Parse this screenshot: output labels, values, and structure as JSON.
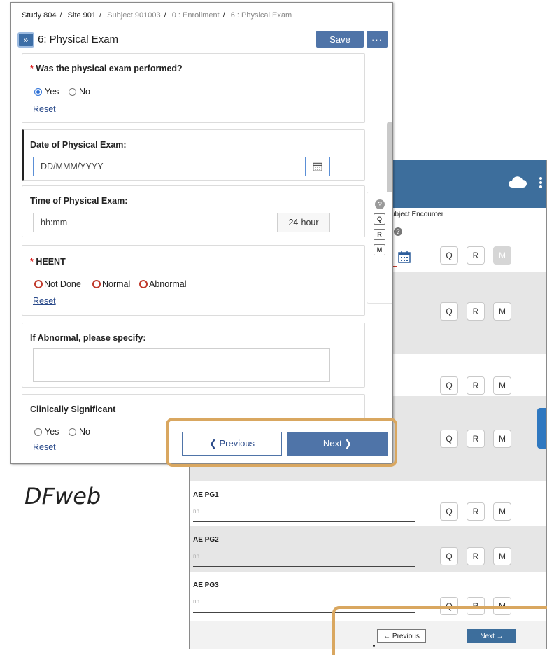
{
  "caption": "DFweb",
  "front": {
    "breadcrumb": [
      {
        "text": "Study 804",
        "muted": false
      },
      {
        "text": "Site 901",
        "muted": false
      },
      {
        "text": "Subject 901003",
        "muted": true
      },
      {
        "text": "0 : Enrollment",
        "muted": true
      },
      {
        "text": "6 : Physical Exam",
        "muted": true
      }
    ],
    "expand_glyph": "»",
    "title": "6: Physical Exam",
    "save_label": "Save",
    "more_label": "···",
    "q1": {
      "required": "*",
      "label": "Was the physical exam performed?",
      "opt_yes": "Yes",
      "opt_no": "No",
      "selected": "Yes",
      "reset": "Reset"
    },
    "q2": {
      "label": "Date of Physical Exam:",
      "placeholder": "DD/MMM/YYYY"
    },
    "q3": {
      "label": "Time of Physical Exam:",
      "placeholder": "hh:mm",
      "suffix": "24-hour"
    },
    "q4": {
      "required": "*",
      "label": "HEENT",
      "opt1": "Not Done",
      "opt2": "Normal",
      "opt3": "Abnormal",
      "reset": "Reset"
    },
    "q5": {
      "label": "If Abnormal, please specify:"
    },
    "q6": {
      "label": "Clinically Significant",
      "opt_yes": "Yes",
      "opt_no": "No",
      "reset": "Reset"
    },
    "side_tools": {
      "help": "?",
      "q": "Q",
      "r": "R",
      "m": "M"
    },
    "prev_label": "❮ Previous",
    "next_label": "Next ❯"
  },
  "tablet": {
    "crumb": "ubject Encounter",
    "help": "?",
    "qrm": {
      "q": "Q",
      "r": "R",
      "m": "M"
    },
    "fields": [
      {
        "label": "AE PG1",
        "placeholder": "nn"
      },
      {
        "label": "AE PG2",
        "placeholder": "nn"
      },
      {
        "label": "AE PG3",
        "placeholder": "nn"
      }
    ],
    "prev_label": "← Previous",
    "next_label": "Next →"
  },
  "colors": {
    "accent": "#4f74a8",
    "topbar": "#3d6e9c",
    "highlight": "#d9a760",
    "required": "#dd2222"
  }
}
